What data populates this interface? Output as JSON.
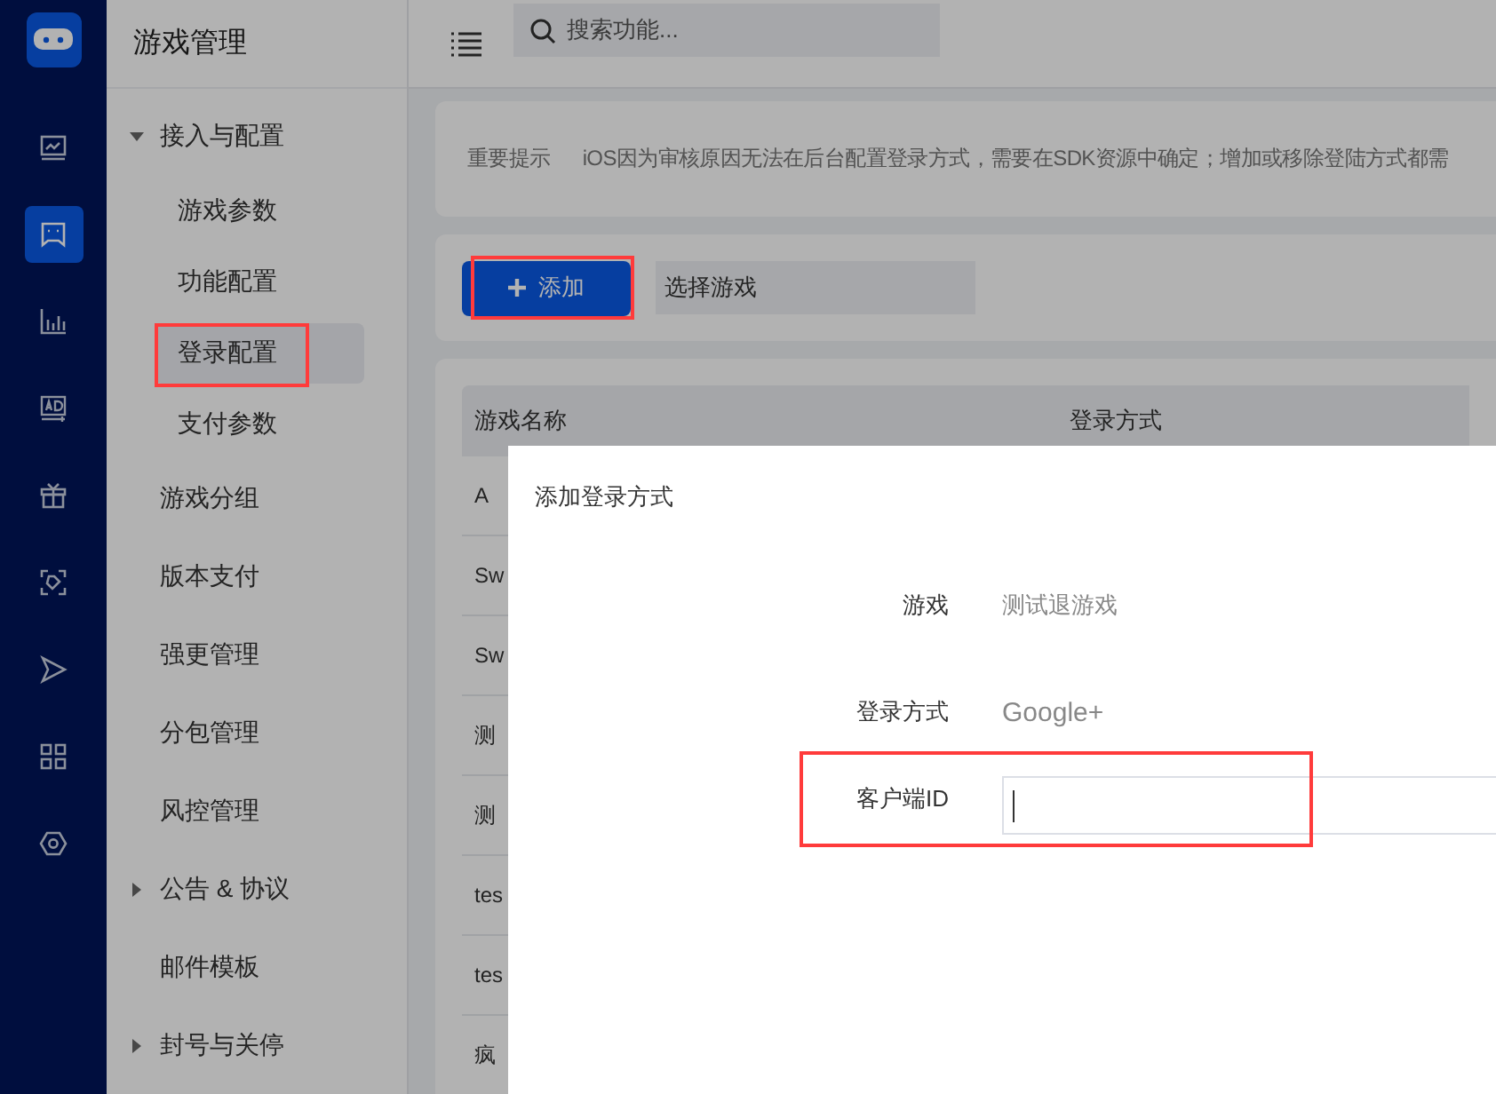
{
  "rail": {
    "items": [
      {
        "selected": false
      },
      {
        "selected": true
      },
      {
        "selected": false
      },
      {
        "selected": false
      },
      {
        "selected": false
      },
      {
        "selected": false
      },
      {
        "selected": false
      },
      {
        "selected": false
      },
      {
        "selected": false
      }
    ]
  },
  "sidebar": {
    "title": "游戏管理",
    "items": [
      {
        "kind": "group",
        "label": "接入与配置",
        "expanded": true,
        "children": [
          {
            "label": "游戏参数",
            "selected": false,
            "highlighted": false
          },
          {
            "label": "功能配置",
            "selected": false,
            "highlighted": false
          },
          {
            "label": "登录配置",
            "selected": true,
            "highlighted": true
          },
          {
            "label": "支付参数",
            "selected": false,
            "highlighted": false
          }
        ]
      },
      {
        "kind": "link",
        "label": "游戏分组",
        "selected": false
      },
      {
        "kind": "link",
        "label": "版本支付",
        "selected": false
      },
      {
        "kind": "link",
        "label": "强更管理",
        "selected": false
      },
      {
        "kind": "link",
        "label": "分包管理",
        "selected": false
      },
      {
        "kind": "link",
        "label": "风控管理",
        "selected": false
      },
      {
        "kind": "group",
        "label": "公告 & 协议",
        "expanded": false
      },
      {
        "kind": "link",
        "label": "邮件模板",
        "selected": false
      },
      {
        "kind": "group",
        "label": "封号与关停",
        "expanded": false
      }
    ]
  },
  "header": {
    "search": {
      "placeholder": "搜索功能..."
    }
  },
  "notice": {
    "label": "重要提示",
    "text": "iOS因为审核原因无法在后台配置登录方式，需要在SDK资源中确定；增加或移除登陆方式都需"
  },
  "toolbar": {
    "add_button": {
      "label": "添加",
      "highlighted": true
    },
    "game_select": {
      "placeholder": "选择游戏"
    }
  },
  "table": {
    "columns": [
      "游戏名称",
      "登录方式"
    ],
    "rows": [
      {
        "name": "A"
      },
      {
        "name": "Sw"
      },
      {
        "name": "Sw"
      },
      {
        "name": "测"
      },
      {
        "name": "测"
      },
      {
        "name": "tes"
      },
      {
        "name": "tes"
      },
      {
        "name": "疯"
      }
    ]
  },
  "dialog": {
    "title": "添加登录方式",
    "fields": [
      {
        "kind": "static",
        "label": "游戏",
        "value": "测试退游戏",
        "highlighted": false
      },
      {
        "kind": "static",
        "label": "登录方式",
        "value": "Google+",
        "highlighted": false
      },
      {
        "kind": "input",
        "label": "客户端ID",
        "focused": true,
        "highlighted": true
      }
    ]
  }
}
